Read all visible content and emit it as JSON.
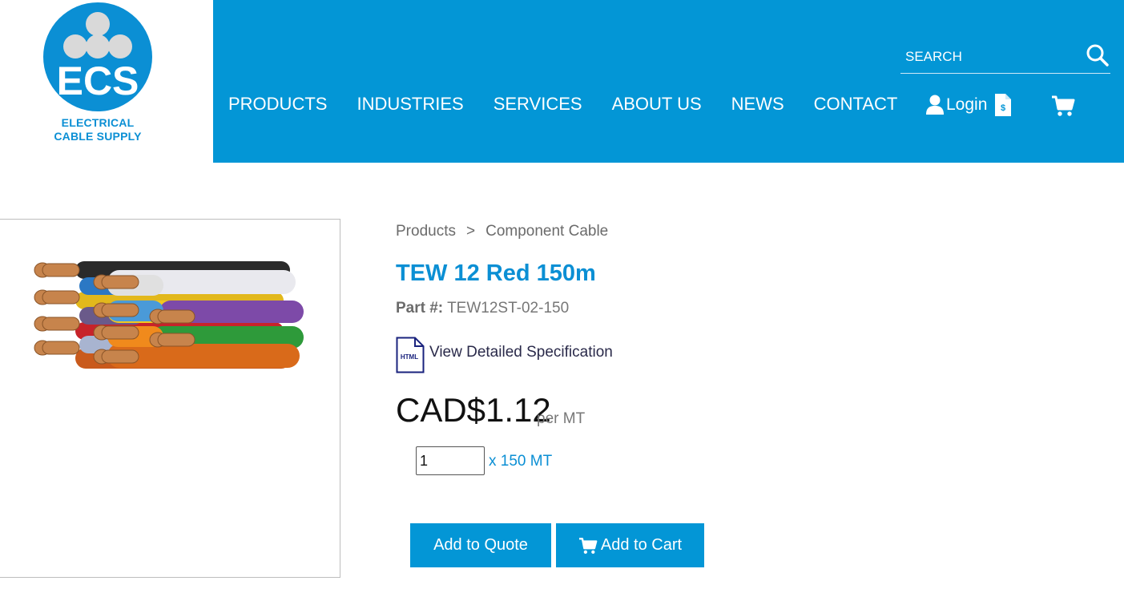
{
  "brand": {
    "logo_letters": "ECS",
    "logo_line1": "ELECTRICAL",
    "logo_line2": "CABLE SUPPLY",
    "primary_color": "#0396d6"
  },
  "nav": {
    "items": [
      {
        "label": "PRODUCTS"
      },
      {
        "label": "INDUSTRIES"
      },
      {
        "label": "SERVICES"
      },
      {
        "label": "ABOUT US"
      },
      {
        "label": "NEWS"
      },
      {
        "label": "CONTACT"
      }
    ]
  },
  "search": {
    "placeholder": "SEARCH",
    "icon": "search-icon"
  },
  "account": {
    "login_label": "Login",
    "user_icon": "user-icon",
    "quote_icon": "quote-document-icon",
    "cart_icon": "cart-icon"
  },
  "breadcrumb": {
    "items": [
      "Products",
      "Component Cable"
    ],
    "separator": ">"
  },
  "product": {
    "title": "TEW 12 Red 150m",
    "part_label": "Part #:",
    "part_number": "TEW12ST-02-150",
    "spec_link": "View Detailed Specification",
    "spec_icon_text": "HTML",
    "price": "CAD$1.12",
    "price_unit": "per MT",
    "quantity": "1",
    "quantity_unit": "x 150 MT"
  },
  "actions": {
    "add_to_quote": "Add to Quote",
    "add_to_cart": "Add to Cart"
  }
}
